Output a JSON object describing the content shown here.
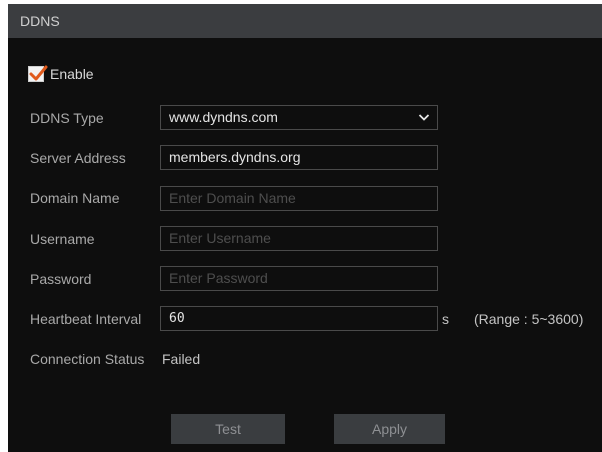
{
  "title": "DDNS",
  "enable": {
    "label": "Enable",
    "checked": true,
    "check_color": "#e05a1c"
  },
  "fields": {
    "ddns_type": {
      "label": "DDNS Type",
      "value": "www.dyndns.com",
      "icon": "chevron-down-icon"
    },
    "server_address": {
      "label": "Server Address",
      "value": "members.dyndns.org"
    },
    "domain_name": {
      "label": "Domain Name",
      "placeholder": "Enter Domain Name"
    },
    "username": {
      "label": "Username",
      "placeholder": "Enter Username"
    },
    "password": {
      "label": "Password",
      "placeholder": "Enter Password"
    },
    "heartbeat": {
      "label": "Heartbeat Interval",
      "value": "60",
      "unit": "s",
      "range": "(Range : 5~3600)"
    }
  },
  "status": {
    "label": "Connection Status",
    "value": "Failed"
  },
  "buttons": {
    "test": "Test",
    "apply": "Apply"
  }
}
